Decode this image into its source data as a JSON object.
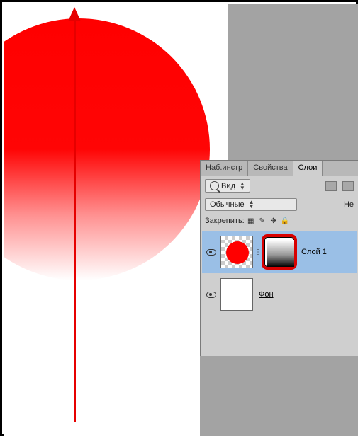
{
  "tabs": {
    "tools": "Наб.инстр",
    "props": "Свойства",
    "layers": "Слои"
  },
  "filter": {
    "kind": "Вид"
  },
  "blend": {
    "mode": "Обычные",
    "opacity_abbr": "Не"
  },
  "lock": {
    "label": "Закрепить:"
  },
  "layers_list": {
    "layer1": "Слой 1",
    "bg": "Фон"
  }
}
